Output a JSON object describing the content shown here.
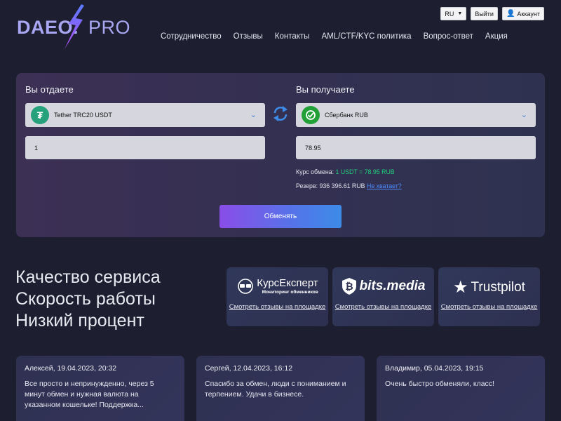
{
  "header": {
    "logo_main": "DAEO.",
    "logo_pro": "PRO",
    "lang": "RU",
    "logout": "Выйти",
    "account": "Аккаунт",
    "nav": [
      "Сотрудничество",
      "Отзывы",
      "Контакты",
      "AML/CTF/KYC политика",
      "Вопрос-ответ",
      "Акция"
    ]
  },
  "exchange": {
    "give_title": "Вы отдаете",
    "get_title": "Вы получаете",
    "give_currency": "Tether TRC20 USDT",
    "get_currency": "Сбербанк RUB",
    "give_amount": "1",
    "get_amount": "78.95",
    "rate_label": "Курс обмена:",
    "rate_value": "1 USDT = 78.95 RUB",
    "reserve_label": "Резерв: 936 396.61 RUB",
    "not_enough": "Не хватает?",
    "button": "Обменять",
    "colors": {
      "tether": "#26a17b",
      "sber": "#21a038",
      "accent": "#4d7ae9"
    }
  },
  "hero": {
    "lines": [
      "Качество сервиса",
      "Скорость работы",
      "Низкий процент"
    ]
  },
  "badges": [
    {
      "name": "КурсЕксперт",
      "sub": "Мониторинг обменников",
      "link": "Смотреть отзывы на площадке"
    },
    {
      "name": "bits.media",
      "link": "Смотреть отзывы на площадке"
    },
    {
      "name": "Trustpilot",
      "link": "Смотреть отзывы на площадке"
    }
  ],
  "reviews": [
    {
      "head": "Алексей, 19.04.2023, 20:32",
      "text": "Все просто и непринужденно, через 5 минут обмен и нужная валюта на указанном кошельке! Поддержка..."
    },
    {
      "head": "Сергей, 12.04.2023, 16:12",
      "text": "Спасибо за обмен, люди с пониманием и терпением. Удачи в бизнесе."
    },
    {
      "head": "Владимир, 05.04.2023, 19:15",
      "text": "Очень быстро обменяли, класс!"
    }
  ]
}
